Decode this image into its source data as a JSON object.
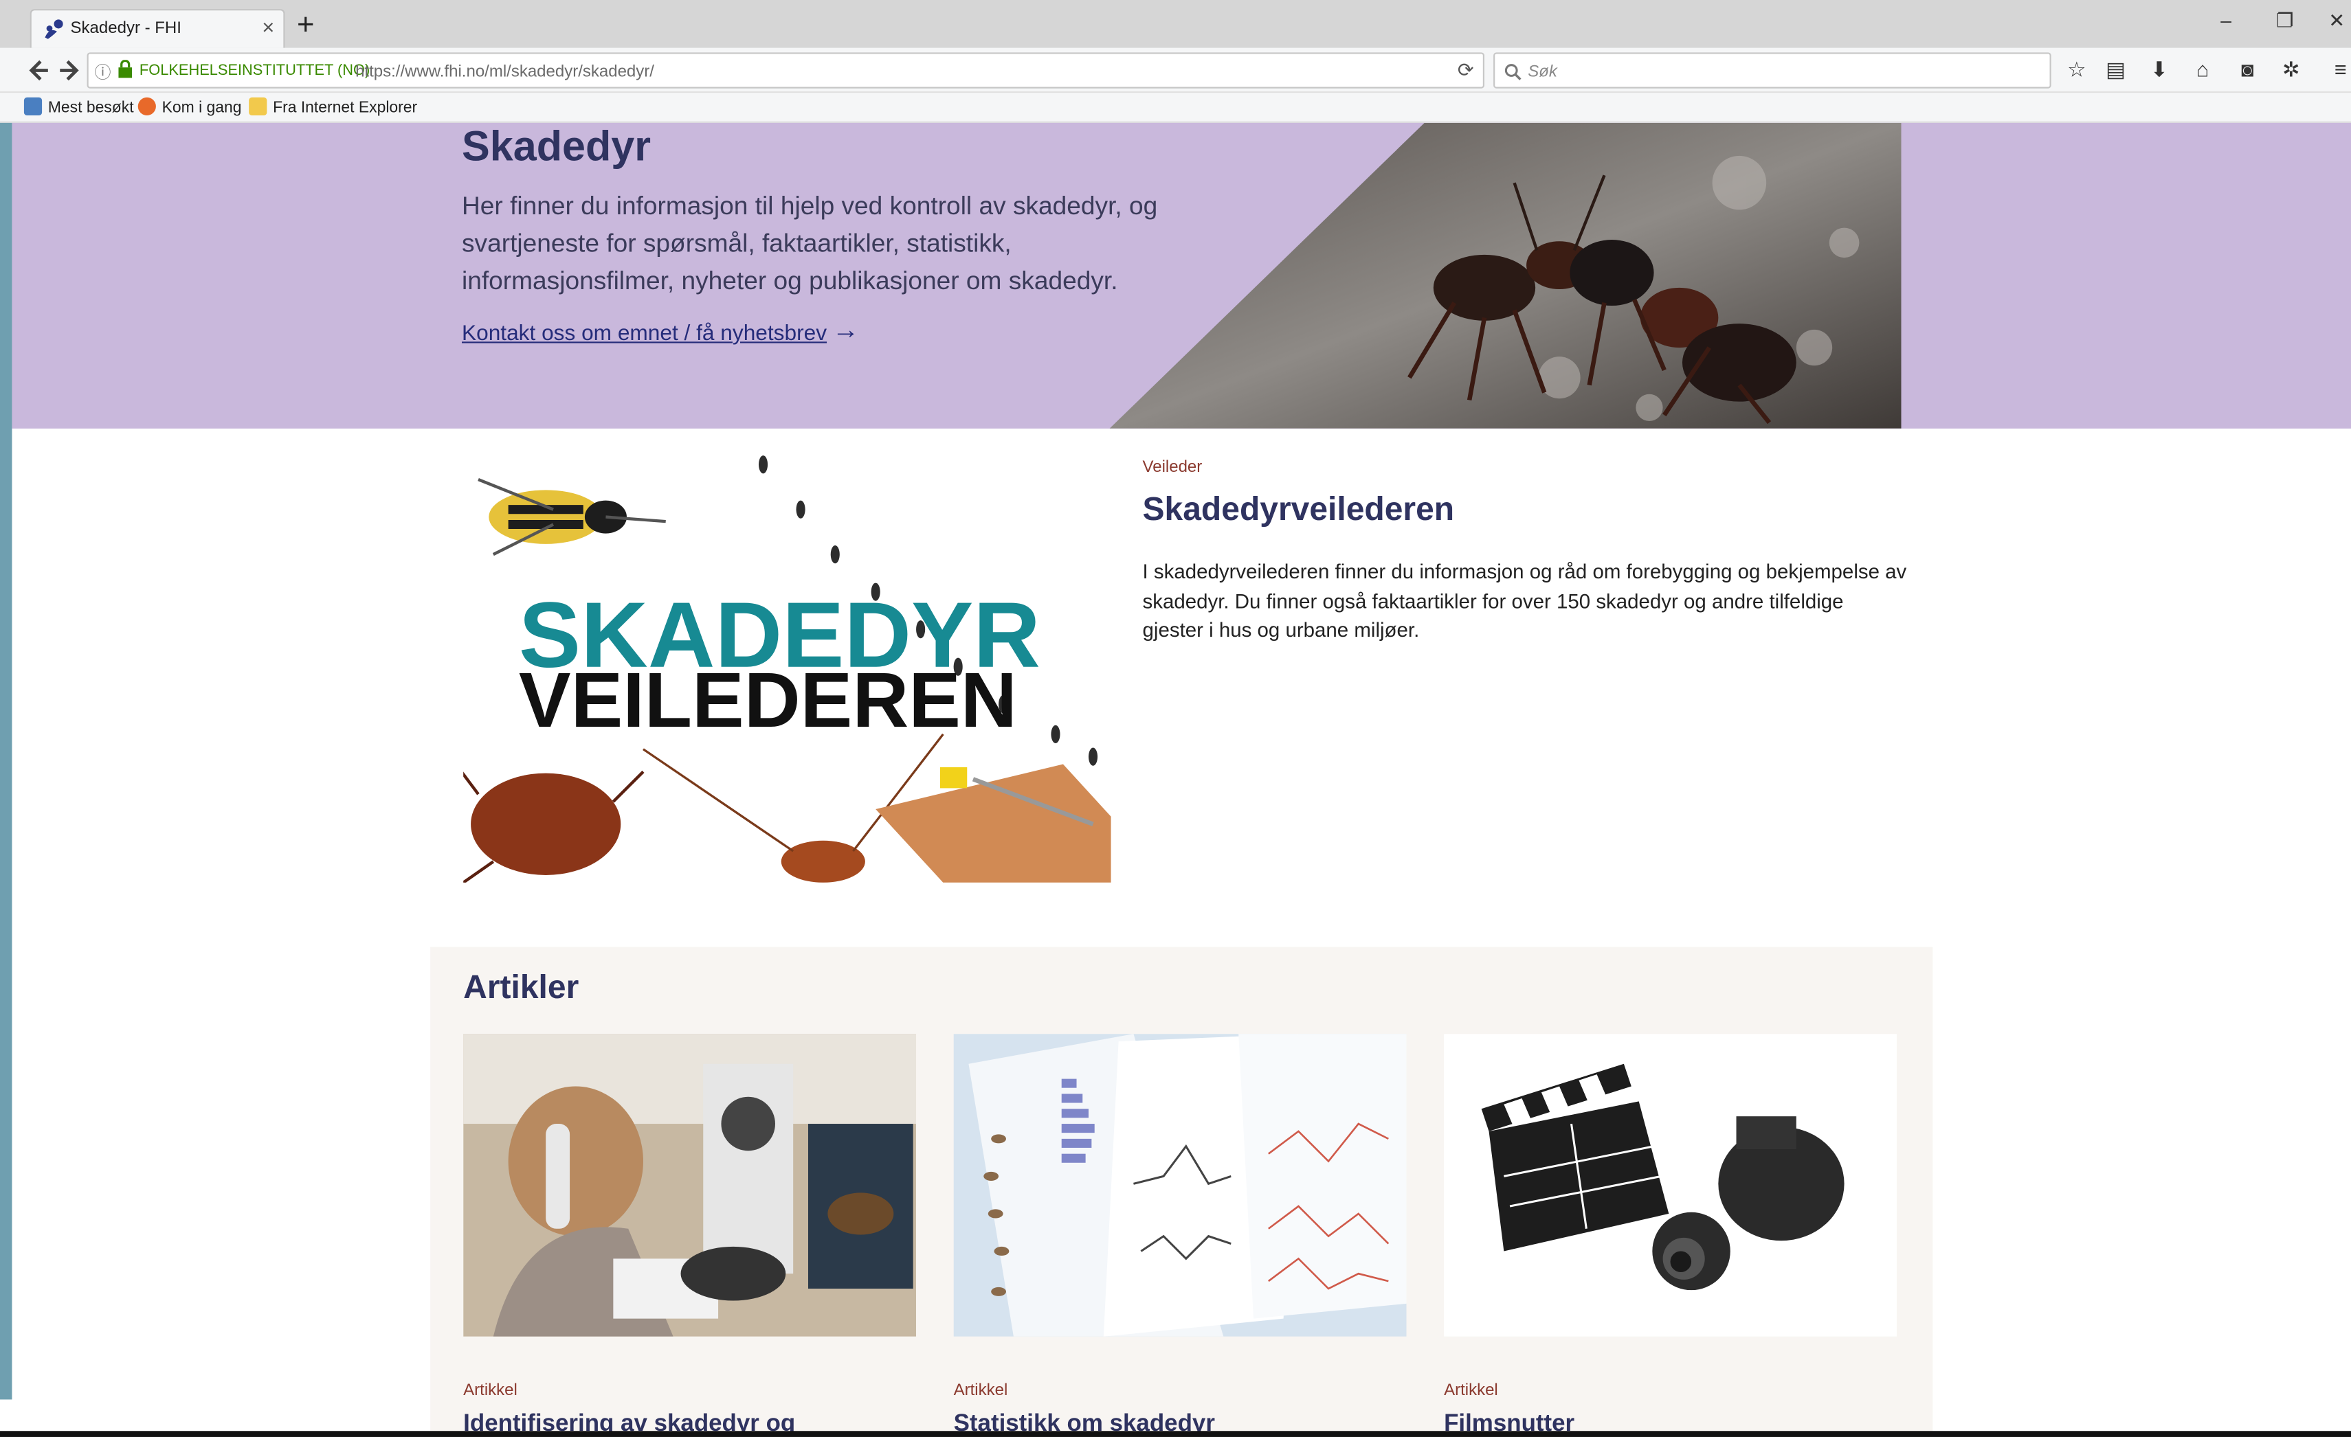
{
  "browser": {
    "tab_title": "Skadedyr - FHI",
    "tab_close": "×",
    "new_tab": "+",
    "win_min": "–",
    "win_restore": "❐",
    "win_close": "✕",
    "url_org": "FOLKEHELSEINSTITUTTET (NO)",
    "url": "https://www.fhi.no/ml/skadedyr/skadedyr/",
    "search_placeholder": "Søk",
    "bookmarks": [
      "Mest besøkt",
      "Kom i gang",
      "Fra Internet Explorer"
    ],
    "colors": {
      "url_org": "#3a8a00",
      "fhi_blue": "#2a3a8c"
    }
  },
  "hero": {
    "title": "Skadedyr",
    "text": "Her finner du informasjon til hjelp ved kontroll av skadedyr, og svartjeneste for spørsmål, faktaartikler, statistikk, informasjonsfilmer, nyheter og publikasjoner om skadedyr.",
    "link": "Kontakt oss om emnet / få nyhetsbrev",
    "arrow": "→",
    "background": "#c9b8dc"
  },
  "feature": {
    "image_text_1": "SKADEDYR",
    "image_text_2": "VEILEDEREN",
    "label": "Veileder",
    "title": "Skadedyrveilederen",
    "text": "I skadedyrveilederen finner du informasjon og råd om forebygging og bekjempelse av skadedyr. Du finner også faktaartikler for over 150 skadedyr og andre tilfeldige gjester i hus og urbane miljøer."
  },
  "articles": {
    "heading": "Artikler",
    "items": [
      {
        "label": "Artikkel",
        "title": "Identifisering av skadedyr og"
      },
      {
        "label": "Artikkel",
        "title": "Statistikk om skadedyr"
      },
      {
        "label": "Artikkel",
        "title": "Filmsnutter"
      }
    ]
  }
}
